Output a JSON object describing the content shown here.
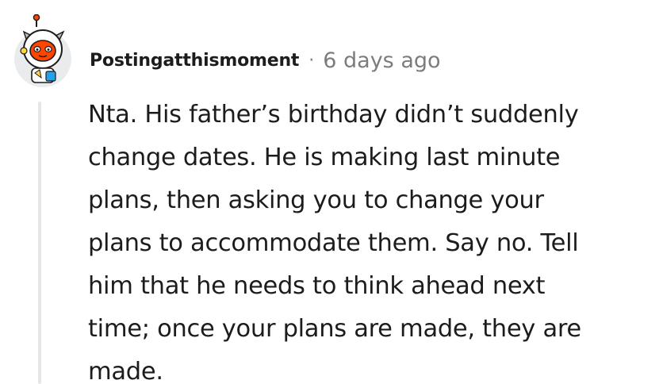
{
  "comment": {
    "username": "Postingatthismoment",
    "separator": "·",
    "timestamp": "6 days ago",
    "avatar_icon": "snoo-astronaut-avatar",
    "body": "Nta.  His father’s birthday didn’t suddenly\nchange dates.  He is making last minute\nplans, then asking you to change your\nplans to accommodate them.  Say no.  Tell\nhim that he needs to think ahead next\ntime; once your plans are made, they are\nmade."
  },
  "colors": {
    "text": "#1c1c1c",
    "meta": "#7c7c7c",
    "thread_line": "#e4e6e8",
    "avatar_bg": "#e9ebed",
    "avatar_accent": "#ff4500"
  }
}
